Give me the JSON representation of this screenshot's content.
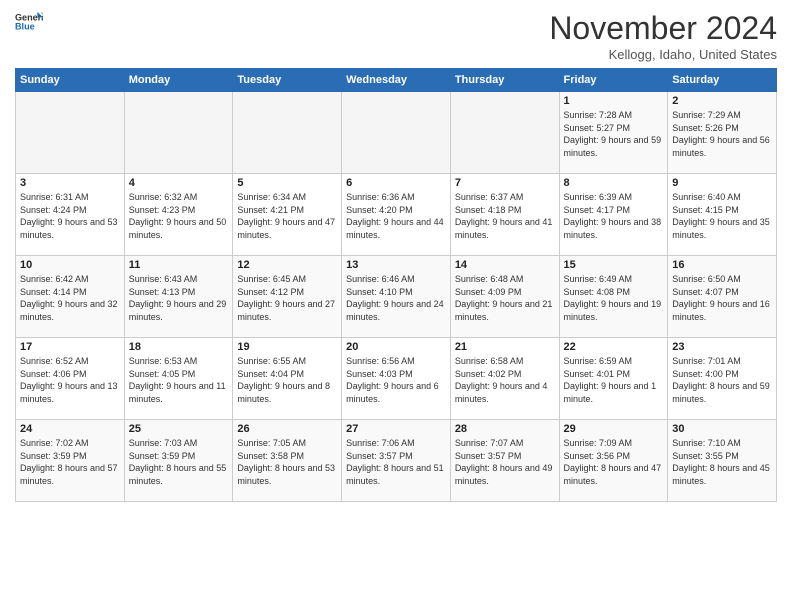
{
  "header": {
    "logo_general": "General",
    "logo_blue": "Blue",
    "month_title": "November 2024",
    "location": "Kellogg, Idaho, United States"
  },
  "days_of_week": [
    "Sunday",
    "Monday",
    "Tuesday",
    "Wednesday",
    "Thursday",
    "Friday",
    "Saturday"
  ],
  "weeks": [
    [
      {
        "day": "",
        "info": ""
      },
      {
        "day": "",
        "info": ""
      },
      {
        "day": "",
        "info": ""
      },
      {
        "day": "",
        "info": ""
      },
      {
        "day": "",
        "info": ""
      },
      {
        "day": "1",
        "info": "Sunrise: 7:28 AM\nSunset: 5:27 PM\nDaylight: 9 hours and 59 minutes."
      },
      {
        "day": "2",
        "info": "Sunrise: 7:29 AM\nSunset: 5:26 PM\nDaylight: 9 hours and 56 minutes."
      }
    ],
    [
      {
        "day": "3",
        "info": "Sunrise: 6:31 AM\nSunset: 4:24 PM\nDaylight: 9 hours and 53 minutes."
      },
      {
        "day": "4",
        "info": "Sunrise: 6:32 AM\nSunset: 4:23 PM\nDaylight: 9 hours and 50 minutes."
      },
      {
        "day": "5",
        "info": "Sunrise: 6:34 AM\nSunset: 4:21 PM\nDaylight: 9 hours and 47 minutes."
      },
      {
        "day": "6",
        "info": "Sunrise: 6:36 AM\nSunset: 4:20 PM\nDaylight: 9 hours and 44 minutes."
      },
      {
        "day": "7",
        "info": "Sunrise: 6:37 AM\nSunset: 4:18 PM\nDaylight: 9 hours and 41 minutes."
      },
      {
        "day": "8",
        "info": "Sunrise: 6:39 AM\nSunset: 4:17 PM\nDaylight: 9 hours and 38 minutes."
      },
      {
        "day": "9",
        "info": "Sunrise: 6:40 AM\nSunset: 4:15 PM\nDaylight: 9 hours and 35 minutes."
      }
    ],
    [
      {
        "day": "10",
        "info": "Sunrise: 6:42 AM\nSunset: 4:14 PM\nDaylight: 9 hours and 32 minutes."
      },
      {
        "day": "11",
        "info": "Sunrise: 6:43 AM\nSunset: 4:13 PM\nDaylight: 9 hours and 29 minutes."
      },
      {
        "day": "12",
        "info": "Sunrise: 6:45 AM\nSunset: 4:12 PM\nDaylight: 9 hours and 27 minutes."
      },
      {
        "day": "13",
        "info": "Sunrise: 6:46 AM\nSunset: 4:10 PM\nDaylight: 9 hours and 24 minutes."
      },
      {
        "day": "14",
        "info": "Sunrise: 6:48 AM\nSunset: 4:09 PM\nDaylight: 9 hours and 21 minutes."
      },
      {
        "day": "15",
        "info": "Sunrise: 6:49 AM\nSunset: 4:08 PM\nDaylight: 9 hours and 19 minutes."
      },
      {
        "day": "16",
        "info": "Sunrise: 6:50 AM\nSunset: 4:07 PM\nDaylight: 9 hours and 16 minutes."
      }
    ],
    [
      {
        "day": "17",
        "info": "Sunrise: 6:52 AM\nSunset: 4:06 PM\nDaylight: 9 hours and 13 minutes."
      },
      {
        "day": "18",
        "info": "Sunrise: 6:53 AM\nSunset: 4:05 PM\nDaylight: 9 hours and 11 minutes."
      },
      {
        "day": "19",
        "info": "Sunrise: 6:55 AM\nSunset: 4:04 PM\nDaylight: 9 hours and 8 minutes."
      },
      {
        "day": "20",
        "info": "Sunrise: 6:56 AM\nSunset: 4:03 PM\nDaylight: 9 hours and 6 minutes."
      },
      {
        "day": "21",
        "info": "Sunrise: 6:58 AM\nSunset: 4:02 PM\nDaylight: 9 hours and 4 minutes."
      },
      {
        "day": "22",
        "info": "Sunrise: 6:59 AM\nSunset: 4:01 PM\nDaylight: 9 hours and 1 minute."
      },
      {
        "day": "23",
        "info": "Sunrise: 7:01 AM\nSunset: 4:00 PM\nDaylight: 8 hours and 59 minutes."
      }
    ],
    [
      {
        "day": "24",
        "info": "Sunrise: 7:02 AM\nSunset: 3:59 PM\nDaylight: 8 hours and 57 minutes."
      },
      {
        "day": "25",
        "info": "Sunrise: 7:03 AM\nSunset: 3:59 PM\nDaylight: 8 hours and 55 minutes."
      },
      {
        "day": "26",
        "info": "Sunrise: 7:05 AM\nSunset: 3:58 PM\nDaylight: 8 hours and 53 minutes."
      },
      {
        "day": "27",
        "info": "Sunrise: 7:06 AM\nSunset: 3:57 PM\nDaylight: 8 hours and 51 minutes."
      },
      {
        "day": "28",
        "info": "Sunrise: 7:07 AM\nSunset: 3:57 PM\nDaylight: 8 hours and 49 minutes."
      },
      {
        "day": "29",
        "info": "Sunrise: 7:09 AM\nSunset: 3:56 PM\nDaylight: 8 hours and 47 minutes."
      },
      {
        "day": "30",
        "info": "Sunrise: 7:10 AM\nSunset: 3:55 PM\nDaylight: 8 hours and 45 minutes."
      }
    ]
  ]
}
